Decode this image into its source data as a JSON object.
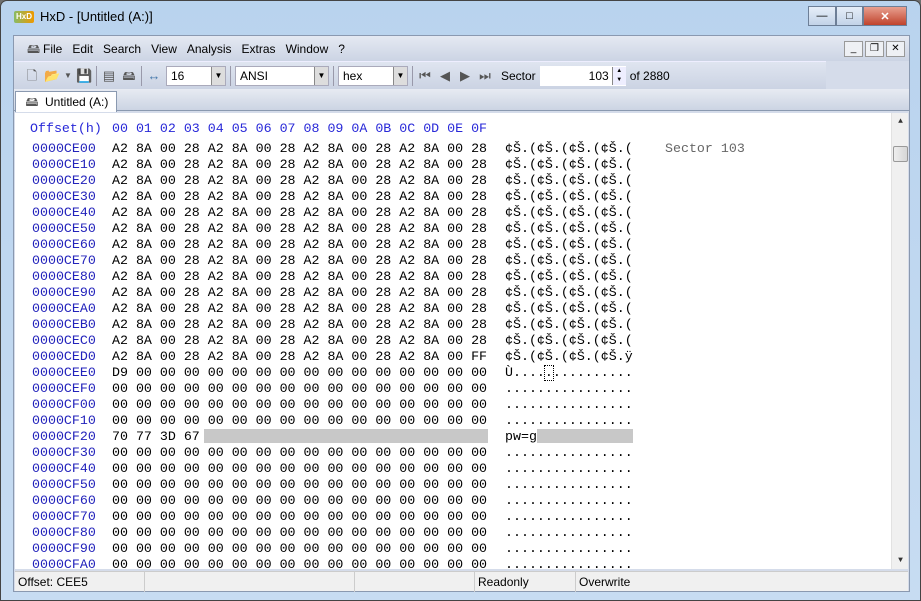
{
  "window": {
    "title": "HxD - [Untitled (A:)]",
    "minimize": "—",
    "maximize": "□",
    "close": "✕"
  },
  "menu": [
    "File",
    "Edit",
    "Search",
    "View",
    "Analysis",
    "Extras",
    "Window",
    "?"
  ],
  "toolbar": {
    "bytes_per_row": "16",
    "charset": "ANSI",
    "display": "hex",
    "sector_label": "Sector",
    "sector_value": "103",
    "sector_total": "of 2880"
  },
  "tab": {
    "label": "Untitled (A:)"
  },
  "editor": {
    "header_offset": "Offset(h)",
    "header_cols": "00 01 02 03 04 05 06 07 08 09 0A 0B 0C 0D 0E 0F",
    "sector_info": "Sector 103",
    "cursor_offset": "0000CEE5",
    "rows": [
      {
        "offset": "0000CE00",
        "hex": "A2 8A 00 28 A2 8A 00 28 A2 8A 00 28 A2 8A 00 28",
        "ascii": "¢Š.(¢Š.(¢Š.(¢Š.("
      },
      {
        "offset": "0000CE10",
        "hex": "A2 8A 00 28 A2 8A 00 28 A2 8A 00 28 A2 8A 00 28",
        "ascii": "¢Š.(¢Š.(¢Š.(¢Š.("
      },
      {
        "offset": "0000CE20",
        "hex": "A2 8A 00 28 A2 8A 00 28 A2 8A 00 28 A2 8A 00 28",
        "ascii": "¢Š.(¢Š.(¢Š.(¢Š.("
      },
      {
        "offset": "0000CE30",
        "hex": "A2 8A 00 28 A2 8A 00 28 A2 8A 00 28 A2 8A 00 28",
        "ascii": "¢Š.(¢Š.(¢Š.(¢Š.("
      },
      {
        "offset": "0000CE40",
        "hex": "A2 8A 00 28 A2 8A 00 28 A2 8A 00 28 A2 8A 00 28",
        "ascii": "¢Š.(¢Š.(¢Š.(¢Š.("
      },
      {
        "offset": "0000CE50",
        "hex": "A2 8A 00 28 A2 8A 00 28 A2 8A 00 28 A2 8A 00 28",
        "ascii": "¢Š.(¢Š.(¢Š.(¢Š.("
      },
      {
        "offset": "0000CE60",
        "hex": "A2 8A 00 28 A2 8A 00 28 A2 8A 00 28 A2 8A 00 28",
        "ascii": "¢Š.(¢Š.(¢Š.(¢Š.("
      },
      {
        "offset": "0000CE70",
        "hex": "A2 8A 00 28 A2 8A 00 28 A2 8A 00 28 A2 8A 00 28",
        "ascii": "¢Š.(¢Š.(¢Š.(¢Š.("
      },
      {
        "offset": "0000CE80",
        "hex": "A2 8A 00 28 A2 8A 00 28 A2 8A 00 28 A2 8A 00 28",
        "ascii": "¢Š.(¢Š.(¢Š.(¢Š.("
      },
      {
        "offset": "0000CE90",
        "hex": "A2 8A 00 28 A2 8A 00 28 A2 8A 00 28 A2 8A 00 28",
        "ascii": "¢Š.(¢Š.(¢Š.(¢Š.("
      },
      {
        "offset": "0000CEA0",
        "hex": "A2 8A 00 28 A2 8A 00 28 A2 8A 00 28 A2 8A 00 28",
        "ascii": "¢Š.(¢Š.(¢Š.(¢Š.("
      },
      {
        "offset": "0000CEB0",
        "hex": "A2 8A 00 28 A2 8A 00 28 A2 8A 00 28 A2 8A 00 28",
        "ascii": "¢Š.(¢Š.(¢Š.(¢Š.("
      },
      {
        "offset": "0000CEC0",
        "hex": "A2 8A 00 28 A2 8A 00 28 A2 8A 00 28 A2 8A 00 28",
        "ascii": "¢Š.(¢Š.(¢Š.(¢Š.("
      },
      {
        "offset": "0000CED0",
        "hex": "A2 8A 00 28 A2 8A 00 28 A2 8A 00 28 A2 8A 00 FF",
        "ascii": "¢Š.(¢Š.(¢Š.(¢Š.ÿ"
      },
      {
        "offset": "0000CEE0",
        "hex": "D9 00 00 00 00 00 00 00 00 00 00 00 00 00 00 00",
        "ascii": "Ù...............",
        "cursor": 5
      },
      {
        "offset": "0000CEF0",
        "hex": "00 00 00 00 00 00 00 00 00 00 00 00 00 00 00 00",
        "ascii": "................"
      },
      {
        "offset": "0000CF00",
        "hex": "00 00 00 00 00 00 00 00 00 00 00 00 00 00 00 00",
        "ascii": "................"
      },
      {
        "offset": "0000CF10",
        "hex": "00 00 00 00 00 00 00 00 00 00 00 00 00 00 00 00",
        "ascii": "................"
      },
      {
        "offset": "0000CF20",
        "hex": "70 77 3D 67",
        "ascii": "pw=g",
        "redacted": true
      },
      {
        "offset": "0000CF30",
        "hex": "00 00 00 00 00 00 00 00 00 00 00 00 00 00 00 00",
        "ascii": "................"
      },
      {
        "offset": "0000CF40",
        "hex": "00 00 00 00 00 00 00 00 00 00 00 00 00 00 00 00",
        "ascii": "................"
      },
      {
        "offset": "0000CF50",
        "hex": "00 00 00 00 00 00 00 00 00 00 00 00 00 00 00 00",
        "ascii": "................"
      },
      {
        "offset": "0000CF60",
        "hex": "00 00 00 00 00 00 00 00 00 00 00 00 00 00 00 00",
        "ascii": "................"
      },
      {
        "offset": "0000CF70",
        "hex": "00 00 00 00 00 00 00 00 00 00 00 00 00 00 00 00",
        "ascii": "................"
      },
      {
        "offset": "0000CF80",
        "hex": "00 00 00 00 00 00 00 00 00 00 00 00 00 00 00 00",
        "ascii": "................"
      },
      {
        "offset": "0000CF90",
        "hex": "00 00 00 00 00 00 00 00 00 00 00 00 00 00 00 00",
        "ascii": "................"
      },
      {
        "offset": "0000CFA0",
        "hex": "00 00 00 00 00 00 00 00 00 00 00 00 00 00 00 00",
        "ascii": "................"
      }
    ]
  },
  "status": {
    "offset": "Offset: CEE5",
    "mode": "Readonly",
    "insert": "Overwrite"
  }
}
